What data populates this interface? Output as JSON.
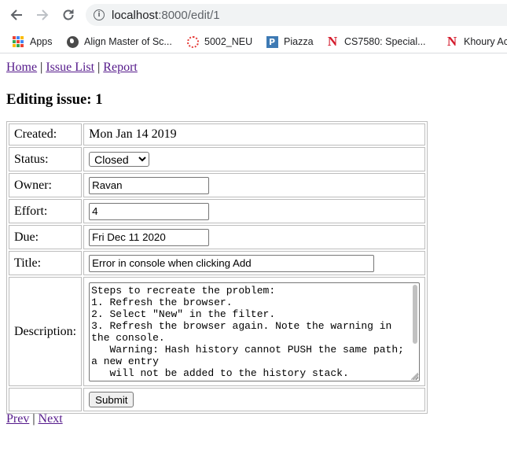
{
  "browser": {
    "url_host": "localhost",
    "url_path": ":8000/edit/1",
    "bookmarks": [
      {
        "label": "Apps",
        "icon": "apps-grid-icon"
      },
      {
        "label": "Align Master of Sc...",
        "icon": "globe-icon"
      },
      {
        "label": "5002_NEU",
        "icon": "dotted-ring-icon"
      },
      {
        "label": "Piazza",
        "icon": "piazza-icon"
      },
      {
        "label": "CS7580: Special...",
        "icon": "northeastern-icon"
      },
      {
        "label": "Khoury Ac",
        "icon": "northeastern-icon"
      }
    ]
  },
  "nav": {
    "home": "Home",
    "issue_list": "Issue List",
    "report": "Report",
    "separator": "|"
  },
  "heading": "Editing issue: 1",
  "form": {
    "created_label": "Created:",
    "created_value": "Mon Jan 14 2019",
    "status_label": "Status:",
    "status_value": "Closed",
    "owner_label": "Owner:",
    "owner_value": "Ravan",
    "effort_label": "Effort:",
    "effort_value": "4",
    "due_label": "Due:",
    "due_value": "Fri Dec 11 2020",
    "title_label": "Title:",
    "title_value": "Error in console when clicking Add",
    "description_label": "Description:",
    "description_value": "Steps to recreate the problem:\n1. Refresh the browser.\n2. Select \"New\" in the filter.\n3. Refresh the browser again. Note the warning in the console.\n   Warning: Hash history cannot PUSH the same path; a new entry\n   will not be added to the history stack.",
    "submit_label": "Submit"
  },
  "pager": {
    "prev": "Prev",
    "next": "Next",
    "separator": "|"
  },
  "colors": {
    "link": "#551a8b",
    "border": "#bdbdbd"
  }
}
